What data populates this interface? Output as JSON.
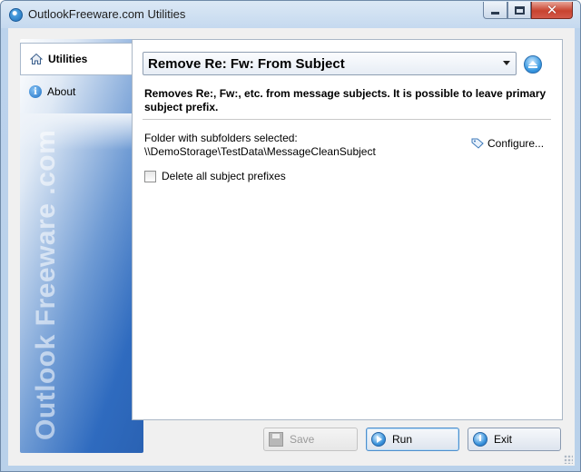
{
  "window": {
    "title": "OutlookFreeware.com Utilities"
  },
  "sidebar": {
    "tabs": [
      {
        "label": "Utilities",
        "icon": "home-icon",
        "selected": true
      },
      {
        "label": "About",
        "icon": "info-icon",
        "selected": false
      }
    ],
    "brand_text": "Outlook Freeware .com"
  },
  "main": {
    "tool_select": {
      "selected": "Remove Re: Fw: From Subject"
    },
    "description": "Removes  Re:, Fw:, etc. from message subjects. It is possible to leave primary subject prefix.",
    "folder_label": "Folder with subfolders selected:",
    "folder_path": "\\\\DemoStorage\\TestData\\MessageCleanSubject",
    "configure_label": "Configure...",
    "checkbox": {
      "label": "Delete all subject prefixes",
      "checked": false
    }
  },
  "footer": {
    "save_label": "Save",
    "run_label": "Run",
    "exit_label": "Exit"
  },
  "colors": {
    "accent": "#2f6bbf",
    "close_button": "#c8432f"
  }
}
